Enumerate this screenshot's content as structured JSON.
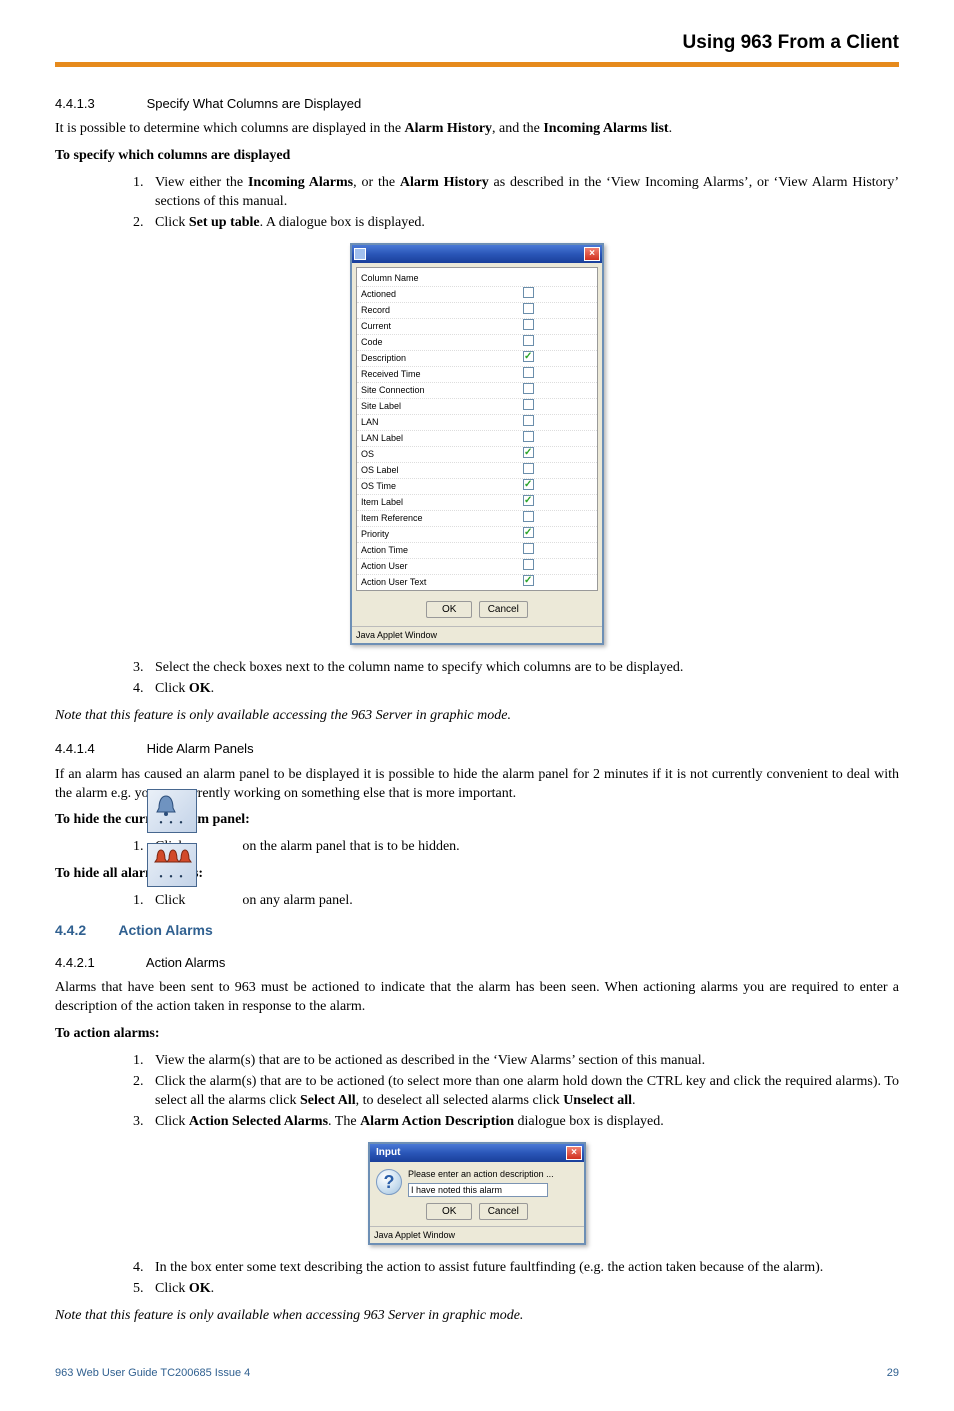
{
  "header": {
    "title": "Using 963 From a Client"
  },
  "sec4413": {
    "num": "4.4.1.3",
    "title": "Specify What Columns are Displayed",
    "intro_a": "It is possible to determine which columns are displayed in the ",
    "intro_b": "Alarm History",
    "intro_c": ", and the ",
    "intro_d": "Incoming Alarms list",
    "intro_e": ".",
    "lead": "To specify which columns are displayed",
    "li1a": "View either the ",
    "li1b": "Incoming Alarms",
    "li1c": ", or the ",
    "li1d": "Alarm History",
    "li1e": " as described in the ‘View Incoming Alarms’, or ‘View Alarm History’ sections of this manual.",
    "li2a": "Click ",
    "li2b": "Set up table",
    "li2c": ". A dialogue box is displayed.",
    "li3": "Select the check boxes next to the column name to specify which columns are to be displayed.",
    "li4a": "Click ",
    "li4b": "OK",
    "li4c": ".",
    "note": "Note that this feature is only available accessing the 963 Server in graphic mode."
  },
  "dlg1": {
    "colhead": "Column Name",
    "rows": [
      {
        "name": "Actioned",
        "on": false
      },
      {
        "name": "Record",
        "on": false
      },
      {
        "name": "Current",
        "on": false
      },
      {
        "name": "Code",
        "on": false
      },
      {
        "name": "Description",
        "on": true
      },
      {
        "name": "Received Time",
        "on": false
      },
      {
        "name": "Site Connection",
        "on": false
      },
      {
        "name": "Site Label",
        "on": false
      },
      {
        "name": "LAN",
        "on": false
      },
      {
        "name": "LAN Label",
        "on": false
      },
      {
        "name": "OS",
        "on": true
      },
      {
        "name": "OS Label",
        "on": false
      },
      {
        "name": "OS Time",
        "on": true
      },
      {
        "name": "Item Label",
        "on": true
      },
      {
        "name": "Item Reference",
        "on": false
      },
      {
        "name": "Priority",
        "on": true
      },
      {
        "name": "Action Time",
        "on": false
      },
      {
        "name": "Action User",
        "on": false
      },
      {
        "name": "Action User Text",
        "on": true
      }
    ],
    "ok": "OK",
    "cancel": "Cancel",
    "status": "Java Applet Window"
  },
  "sec4414": {
    "num": "4.4.1.4",
    "title": "Hide Alarm Panels",
    "intro": "If an alarm has caused an alarm panel to be displayed it is possible to hide the alarm panel for 2 minutes if it is not currently convenient to deal with the alarm e.g. you are currently working on something else that is more important.",
    "lead1": "To hide the current alarm panel:",
    "li1a": "Click ",
    "li1b": " on the alarm panel that is to be hidden.",
    "lead2": "To hide all alarm panels:",
    "li2a": "Click ",
    "li2b": " on any alarm panel."
  },
  "sec442": {
    "num": "4.4.2",
    "title": "Action Alarms"
  },
  "sec4421": {
    "num": "4.4.2.1",
    "title": "Action Alarms",
    "intro": "Alarms that have been sent to 963 must be actioned to indicate that the alarm has been seen. When actioning alarms you are required to enter a description of the action taken in response to the alarm.",
    "lead": "To action alarms:",
    "li1": "View the alarm(s) that are to be actioned as described in the ‘View Alarms’ section of this manual.",
    "li2a": "Click the alarm(s) that are to be actioned (to select more than one alarm hold down the CTRL key and click the required alarms). To select all the alarms click ",
    "li2b": "Select All",
    "li2c": ", to deselect all selected alarms click ",
    "li2d": "Unselect all",
    "li2e": ".",
    "li3a": "Click ",
    "li3b": "Action Selected Alarms",
    "li3c": ". The ",
    "li3d": "Alarm Action Description",
    "li3e": " dialogue box is displayed.",
    "li4": "In the box enter some text describing the action to assist future faultfinding (e.g. the action taken because of the alarm).",
    "li5a": "Click ",
    "li5b": "OK",
    "li5c": ".",
    "note": "Note that this feature is only available when accessing 963 Server in graphic mode."
  },
  "dlg2": {
    "title": "Input",
    "msg": "Please enter an action description ...",
    "value": "I have noted this alarm",
    "ok": "OK",
    "cancel": "Cancel",
    "status": "Java Applet Window"
  },
  "footer": {
    "left": "963 Web User Guide TC200685 Issue 4",
    "right": "29"
  }
}
